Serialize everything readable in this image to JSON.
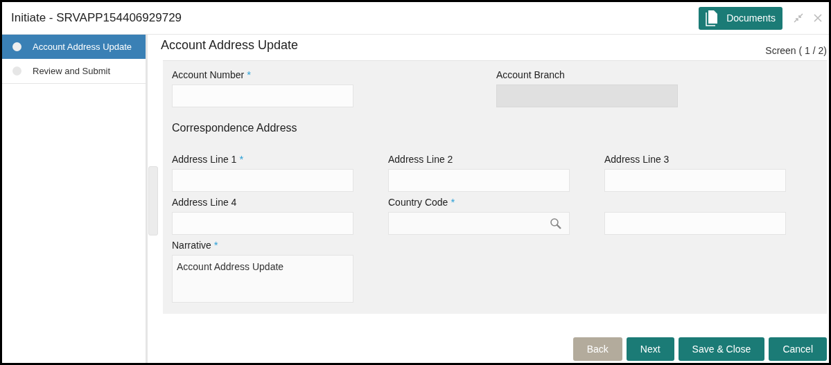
{
  "window": {
    "title": "Initiate - SRVAPP154406929729"
  },
  "documents_button": {
    "label": "Documents"
  },
  "steps": [
    {
      "label": "Account Address Update",
      "selected": true
    },
    {
      "label": "Review and Submit",
      "selected": false
    }
  ],
  "page": {
    "title": "Account Address Update",
    "screen_indicator": "Screen ( 1 / 2)"
  },
  "top_fields": [
    {
      "label": "Account Number",
      "required_mark": "*",
      "disabled": false,
      "kind": "text"
    },
    {
      "label": "Account Branch",
      "disabled": true,
      "kind": "text"
    }
  ],
  "section_heading": "Correspondence Address",
  "address_fields": [
    {
      "label": "Address Line 1",
      "required_mark": "*",
      "kind": "text"
    },
    {
      "label": "Address Line 2",
      "kind": "text"
    },
    {
      "label": "Address Line 3",
      "kind": "text"
    },
    {
      "label": "Address Line 4",
      "kind": "text"
    },
    {
      "label": "Country Code",
      "required_mark": "*",
      "kind": "search"
    },
    {
      "kind": "text"
    },
    {
      "label": "Narrative",
      "required_mark": "*",
      "kind": "textarea",
      "value": "Account Address Update"
    }
  ],
  "buttons": [
    {
      "label": "Back",
      "disabled": true
    },
    {
      "label": "Next",
      "disabled": false
    },
    {
      "label": "Save & Close",
      "disabled": false
    },
    {
      "label": "Cancel",
      "disabled": false
    }
  ]
}
